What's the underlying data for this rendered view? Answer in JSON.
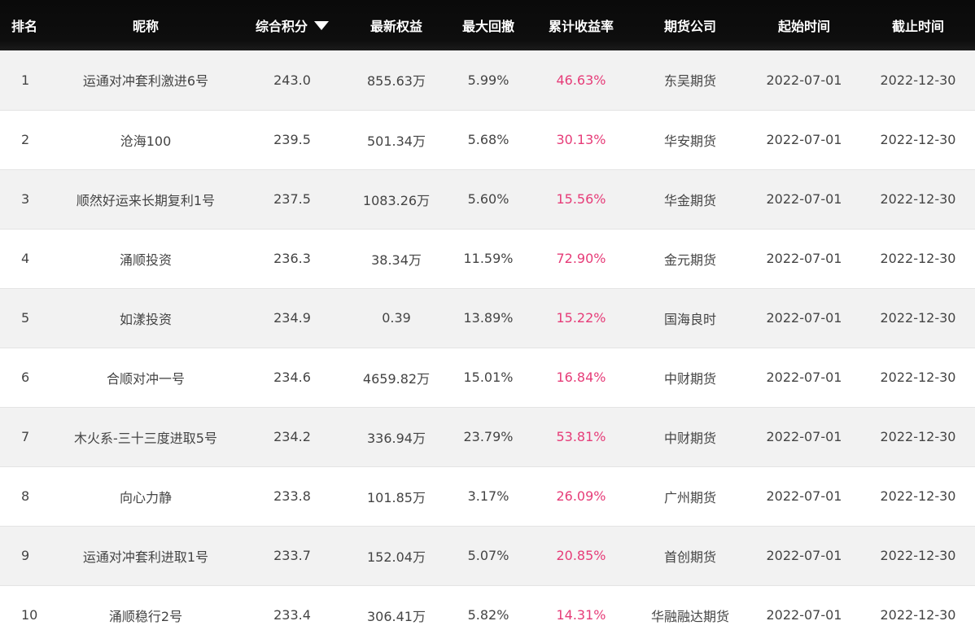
{
  "colors": {
    "header_bg": "#0e0e0e",
    "header_text": "#ffffff",
    "body_text": "#444444",
    "return_text": "#e63c78",
    "row_alt": "#f2f2f2"
  },
  "sort_icon": "triangle-down-icon",
  "header": {
    "rank": "排名",
    "nickname": "昵称",
    "score": "综合积分",
    "equity": "最新权益",
    "max_drawdown": "最大回撤",
    "cum_return": "累计收益率",
    "broker": "期货公司",
    "start": "起始时间",
    "end": "截止时间"
  },
  "rows": [
    {
      "rank": "1",
      "nickname": "运通对冲套利激进6号",
      "score": "243.0",
      "equity": "855.63万",
      "max_drawdown": "5.99%",
      "cum_return": "46.63%",
      "broker": "东吴期货",
      "start": "2022-07-01",
      "end": "2022-12-30"
    },
    {
      "rank": "2",
      "nickname": "沧海100",
      "score": "239.5",
      "equity": "501.34万",
      "max_drawdown": "5.68%",
      "cum_return": "30.13%",
      "broker": "华安期货",
      "start": "2022-07-01",
      "end": "2022-12-30"
    },
    {
      "rank": "3",
      "nickname": "顺然好运来长期复利1号",
      "score": "237.5",
      "equity": "1083.26万",
      "max_drawdown": "5.60%",
      "cum_return": "15.56%",
      "broker": "华金期货",
      "start": "2022-07-01",
      "end": "2022-12-30"
    },
    {
      "rank": "4",
      "nickname": "涌顺投资",
      "score": "236.3",
      "equity": "38.34万",
      "max_drawdown": "11.59%",
      "cum_return": "72.90%",
      "broker": "金元期货",
      "start": "2022-07-01",
      "end": "2022-12-30"
    },
    {
      "rank": "5",
      "nickname": "如漾投资",
      "score": "234.9",
      "equity": "0.39",
      "max_drawdown": "13.89%",
      "cum_return": "15.22%",
      "broker": "国海良时",
      "start": "2022-07-01",
      "end": "2022-12-30"
    },
    {
      "rank": "6",
      "nickname": "合顺对冲一号",
      "score": "234.6",
      "equity": "4659.82万",
      "max_drawdown": "15.01%",
      "cum_return": "16.84%",
      "broker": "中财期货",
      "start": "2022-07-01",
      "end": "2022-12-30"
    },
    {
      "rank": "7",
      "nickname": "木火系-三十三度进取5号",
      "score": "234.2",
      "equity": "336.94万",
      "max_drawdown": "23.79%",
      "cum_return": "53.81%",
      "broker": "中财期货",
      "start": "2022-07-01",
      "end": "2022-12-30"
    },
    {
      "rank": "8",
      "nickname": "向心力静",
      "score": "233.8",
      "equity": "101.85万",
      "max_drawdown": "3.17%",
      "cum_return": "26.09%",
      "broker": "广州期货",
      "start": "2022-07-01",
      "end": "2022-12-30"
    },
    {
      "rank": "9",
      "nickname": "运通对冲套利进取1号",
      "score": "233.7",
      "equity": "152.04万",
      "max_drawdown": "5.07%",
      "cum_return": "20.85%",
      "broker": "首创期货",
      "start": "2022-07-01",
      "end": "2022-12-30"
    },
    {
      "rank": "10",
      "nickname": "涌顺稳行2号",
      "score": "233.4",
      "equity": "306.41万",
      "max_drawdown": "5.82%",
      "cum_return": "14.31%",
      "broker": "华融融达期货",
      "start": "2022-07-01",
      "end": "2022-12-30"
    }
  ]
}
